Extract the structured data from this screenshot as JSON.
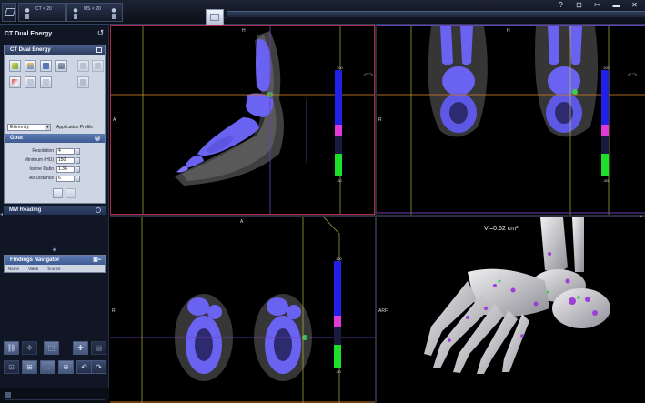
{
  "topbar": {
    "series": [
      {
        "label": "CT < 20"
      },
      {
        "label": "MS < 20"
      }
    ],
    "icons": [
      "help-icon",
      "network-icon",
      "tools-icon",
      "minimize-icon",
      "close-icon"
    ],
    "icon_glyphs": [
      "?",
      "⊞",
      "✂",
      "▬",
      "✕"
    ]
  },
  "left_panel": {
    "app_title": "CT Dual Energy",
    "tool_card": {
      "title": "CT Dual Energy",
      "profile": {
        "value": "Extremity",
        "label": "Application Profile"
      },
      "section": "Gout",
      "params": [
        {
          "label": "Resolution",
          "value": "4"
        },
        {
          "label": "Minimum (HU)",
          "value": "150"
        },
        {
          "label": "Iodine Ratio",
          "value": "1.36"
        },
        {
          "label": "Air Distance",
          "value": "6"
        }
      ]
    },
    "mm_reading": "MM Reading",
    "findings": {
      "title": "Findings Navigator",
      "columns": [
        "Name",
        "Value",
        "Source"
      ]
    }
  },
  "viewports": {
    "sagittal": {
      "orient_top": "H",
      "orient_left": "A",
      "scale_top": "100",
      "scale_bottom": "-50"
    },
    "coronal": {
      "orient_top": "H",
      "orient_left": "R",
      "scale_top": "100",
      "scale_bottom": "-50"
    },
    "axial": {
      "orient_top": "A",
      "orient_left": "R",
      "scale_top": "100",
      "scale_bottom": "-50"
    },
    "volume": {
      "orient_left": "ARF",
      "measurement": "Vi=0.62 cm³"
    }
  },
  "colors": {
    "bone": "#6a62f0",
    "gout_marker": "#39d04a",
    "sagittal_border": "#b5274d",
    "crosshair_orange": "#c87a2a",
    "crosshair_yellow": "#c9c243"
  }
}
